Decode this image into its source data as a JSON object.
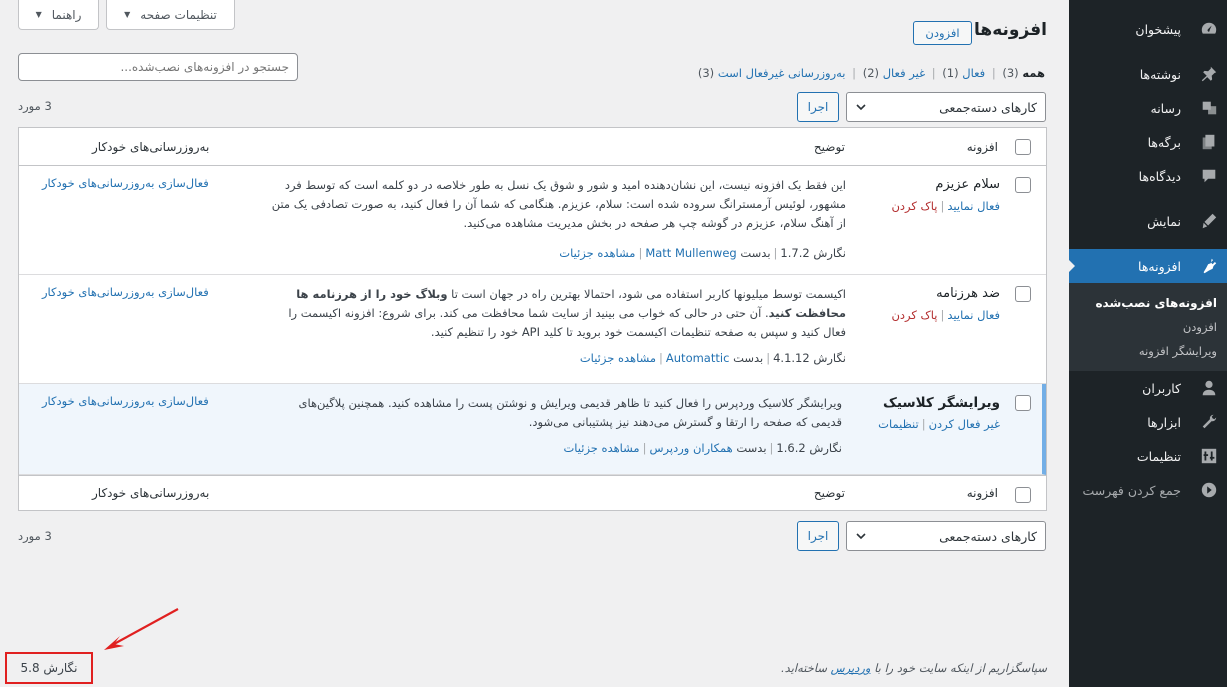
{
  "sidebar": {
    "items": [
      {
        "label": "پیشخوان",
        "icon": "dashboard-icon"
      },
      {
        "label": "نوشته‌ها",
        "icon": "pin-icon"
      },
      {
        "label": "رسانه",
        "icon": "media-icon"
      },
      {
        "label": "برگه‌ها",
        "icon": "pages-icon"
      },
      {
        "label": "دیدگاه‌ها",
        "icon": "comments-icon"
      },
      {
        "label": "نمایش",
        "icon": "appearance-icon"
      },
      {
        "label": "افزونه‌ها",
        "icon": "plugins-icon"
      },
      {
        "label": "کاربران",
        "icon": "users-icon"
      },
      {
        "label": "ابزارها",
        "icon": "tools-icon"
      },
      {
        "label": "تنظیمات",
        "icon": "settings-icon"
      },
      {
        "label": "جمع کردن فهرست",
        "icon": "collapse-icon"
      }
    ],
    "submenu": [
      "افزونه‌های نصب‌شده",
      "افزودن",
      "ویرایشگر افزونه"
    ]
  },
  "topbar": {
    "screen_options": "تنظیمات صفحه",
    "help": "راهنما"
  },
  "page": {
    "title": "افزونه‌ها",
    "add_new": "افزودن"
  },
  "filters": {
    "all": "همه",
    "all_count": "(3)",
    "active": "فعال",
    "active_count": "(1)",
    "inactive": "غیر فعال",
    "inactive_count": "(2)",
    "autoupdate_disabled": "به‌روزرسانی غیرفعال است",
    "autoupdate_disabled_count": "(3)"
  },
  "search": {
    "placeholder": "جستجو در افزونه‌های نصب‌شده..."
  },
  "bulk": {
    "label": "کارهای دسته‌جمعی",
    "apply": "اجرا",
    "count": "3 مورد"
  },
  "table": {
    "columns": {
      "plugin": "افزونه",
      "description": "توضیح",
      "auto_updates": "به‌روزرسانی‌های خودکار"
    },
    "rows": [
      {
        "name": "سلام عزیزم",
        "action1": "فعال نمایید",
        "action2": "پاک کردن",
        "description": "این فقط یک افزونه نیست، این نشان‌دهنده امید و شور و شوق یک نسل به طور خلاصه در دو کلمه است که توسط فرد مشهور، لوئیس آرمسترانگ سروده شده است: سلام، عزیزم. هنگامی که شما آن را فعال کنید، به صورت تصادفی یک متن از آهنگ سلام، عزیزم در گوشه چپ هر صفحه در بخش مدیریت مشاهده می‌کنید.",
        "version": "نگارش 1.7.2",
        "by": "بدست",
        "author": "Matt Mullenweg",
        "details": "مشاهده جزئیات",
        "auto": "فعال‌سازی به‌روزرسانی‌های خودکار"
      },
      {
        "name": "ضد هرزنامه",
        "action1": "فعال نمایید",
        "action2": "پاک کردن",
        "desc_a": "اکیسمت توسط میلیونها کاربر استفاده می شود، احتمالا بهترین راه در جهان است تا ",
        "desc_b": "وبلاگ خود را از هرزنامه ها محافظت کنید",
        "desc_c": ". آن حتی در حالی که خواب می بینید از سایت شما محافظت می کند. برای شروع: افزونه اکیسمت را فعال کنید و سپس به صفحه تنظیمات اکیسمت خود بروید تا کلید API خود را تنظیم کنید.",
        "version": "نگارش 4.1.12",
        "by": "بدست",
        "author": "Automattic",
        "details": "مشاهده جزئیات",
        "auto": "فعال‌سازی به‌روزرسانی‌های خودکار"
      },
      {
        "name": "ویرایشگر کلاسیک",
        "action1": "غیر فعال کردن",
        "action2": "تنظیمات",
        "description": "ویرایشگر کلاسیک وردپرس را فعال کنید تا ظاهر قدیمی ویرایش و نوشتن پست را مشاهده کنید. همچنین پلاگین‌های قدیمی که صفحه را ارتقا و گسترش می‌دهند نیز پشتیبانی می‌شود.",
        "version": "نگارش 1.6.2",
        "by": "بدست",
        "author": "همکاران وردپرس",
        "details": "مشاهده جزئیات",
        "auto": "فعال‌سازی به‌روزرسانی‌های خودکار"
      }
    ]
  },
  "footer": {
    "thanks_a": "سپاسگزاریم از اینکه سایت خود را با ",
    "wordpress": "وردپرس",
    "thanks_b": " ساخته‌اید.",
    "version": "نگارش 5.8"
  },
  "colors": {
    "sidebar": "#1d2327",
    "accent": "#2271b1",
    "highlight": "#e02020"
  }
}
